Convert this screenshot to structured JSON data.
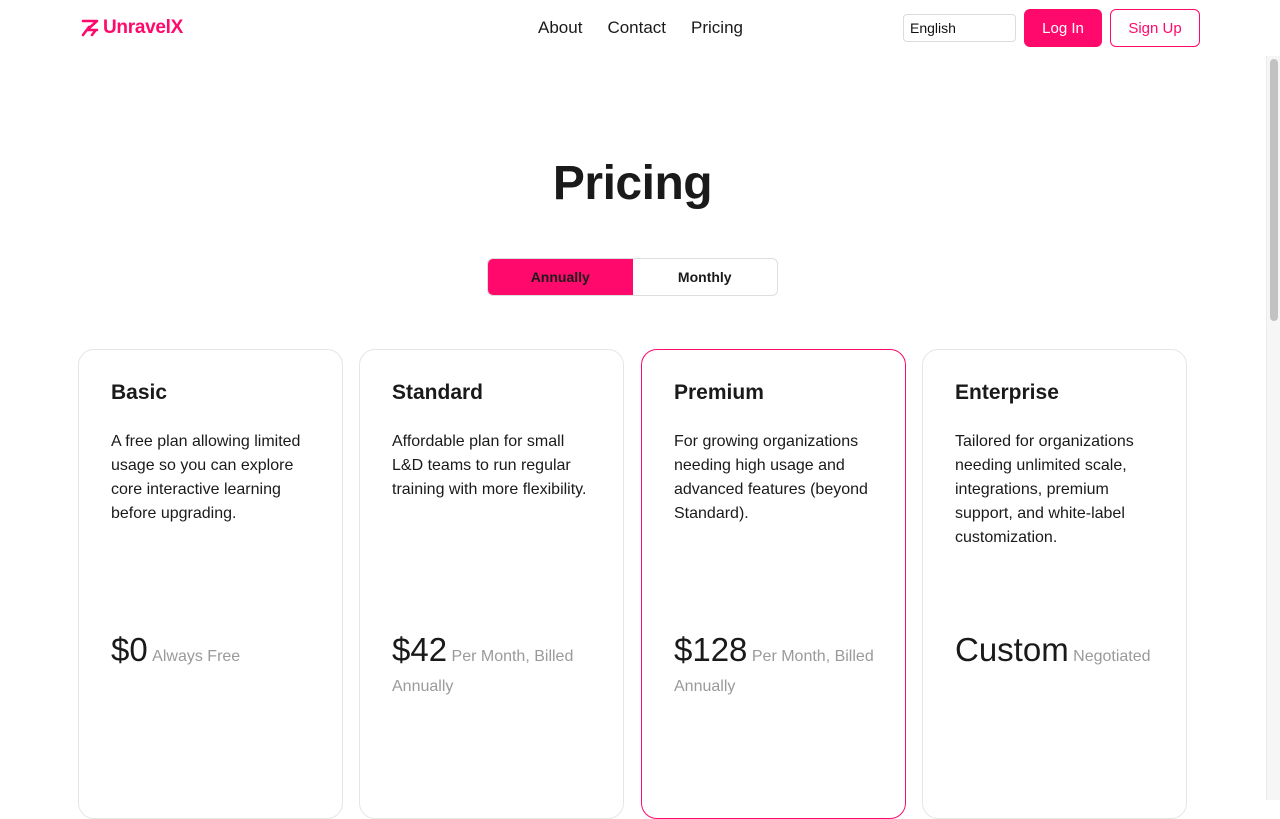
{
  "theme": {
    "accent": "#ff0a6c",
    "text": "#1a1a1a",
    "muted": "#9a9a9a"
  },
  "header": {
    "brand": "UnravelX",
    "brand_icon": "unravelx-logo-icon",
    "nav": [
      {
        "label": "About"
      },
      {
        "label": "Contact"
      },
      {
        "label": "Pricing"
      }
    ],
    "language": {
      "selected": "English"
    },
    "login_label": "Log In",
    "signup_label": "Sign Up"
  },
  "page": {
    "title": "Pricing",
    "billing_toggle": {
      "options": [
        "Annually",
        "Monthly"
      ],
      "selected": "Annually"
    }
  },
  "plans": [
    {
      "name": "Basic",
      "description": "A free plan allowing limited usage so you can explore core interactive learning before upgrading.",
      "price": "$0",
      "price_note": "Always Free",
      "featured": false
    },
    {
      "name": "Standard",
      "description": "Affordable plan for small L&D teams to run regular training with more flexibility.",
      "price": "$42",
      "price_note": "Per Month, Billed Annually",
      "featured": false
    },
    {
      "name": "Premium",
      "description": "For growing organizations needing high usage and advanced features (beyond Standard).",
      "price": "$128",
      "price_note": "Per Month, Billed Annually",
      "featured": true
    },
    {
      "name": "Enterprise",
      "description": "Tailored for organizations needing unlimited scale, integrations, premium support, and white-label customization.",
      "price": "Custom",
      "price_note": "Negotiated",
      "featured": false
    }
  ]
}
